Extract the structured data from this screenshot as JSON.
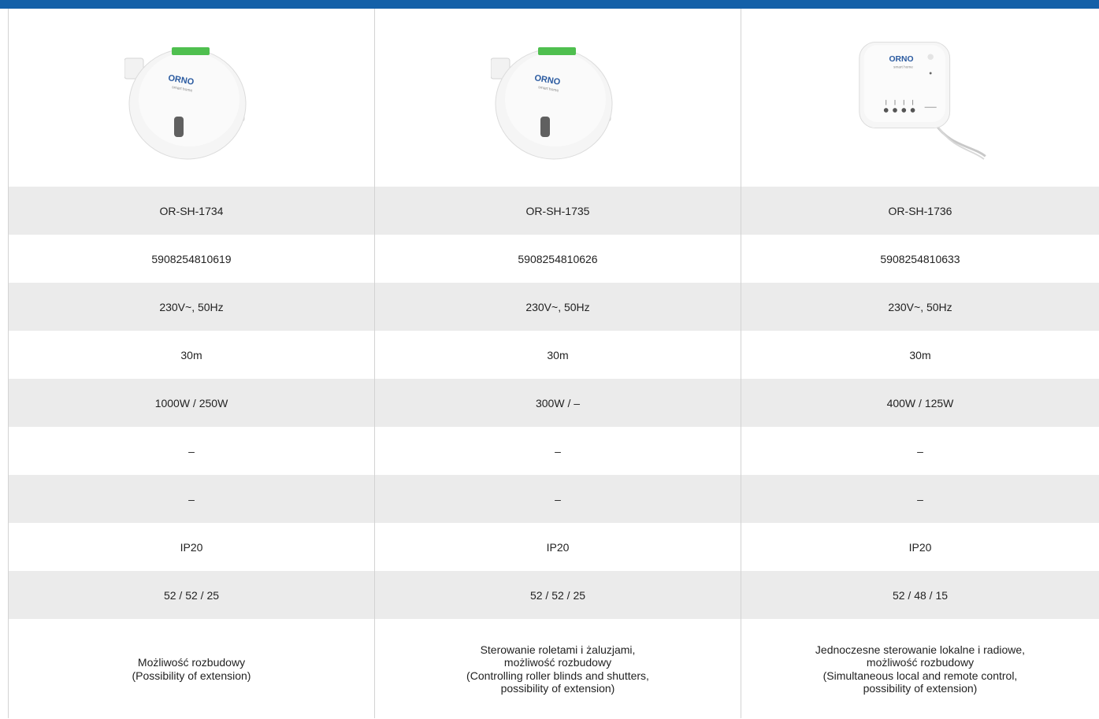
{
  "colors": {
    "header_bar": "#1460a8",
    "row_shade": "#ebebeb",
    "divider": "#d3d3d3"
  },
  "brand": {
    "logo_text": "ORNO",
    "logo_sub": "smart home"
  },
  "products": [
    {
      "image": "round-relay-module",
      "rows": [
        "OR-SH-1734",
        "5908254810619",
        "230V~, 50Hz",
        "30m",
        "1000W / 250W",
        "–",
        "–",
        "IP20",
        "52 / 52 / 25"
      ],
      "description": "Możliwość rozbudowy\n(Possibility of extension)"
    },
    {
      "image": "round-blind-controller-module",
      "rows": [
        "OR-SH-1735",
        "5908254810626",
        "230V~, 50Hz",
        "30m",
        "300W / –",
        "–",
        "–",
        "IP20",
        "52 / 52 / 25"
      ],
      "description": "Sterowanie roletami i żaluzjami,\nmożliwość rozbudowy\n(Controlling roller blinds and shutters,\npossibility of extension)"
    },
    {
      "image": "square-wired-module",
      "rows": [
        "OR-SH-1736",
        "5908254810633",
        "230V~, 50Hz",
        "30m",
        "400W / 125W",
        "–",
        "–",
        "IP20",
        "52 / 48 / 15"
      ],
      "description": "Jednoczesne sterowanie lokalne i radiowe,\nmożliwość rozbudowy\n(Simultaneous local and remote control,\npossibility of extension)"
    }
  ]
}
